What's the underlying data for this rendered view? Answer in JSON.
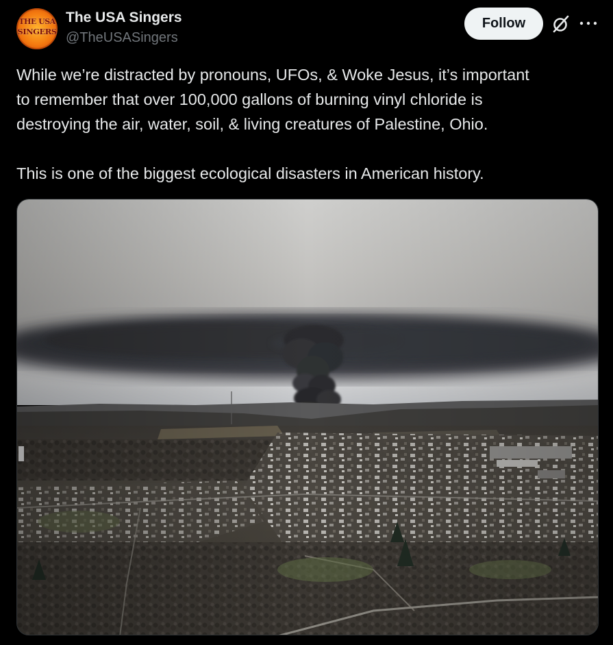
{
  "author": {
    "display_name": "The USA Singers",
    "handle": "@TheUSASingers",
    "avatar": {
      "logo_line1": "THE USA",
      "logo_line2": "SINGERS"
    }
  },
  "actions": {
    "follow_label": "Follow",
    "grok_icon": "grok-icon",
    "more_icon": "more-icon"
  },
  "tweet": {
    "lines_paragraph1": [
      "While we’re distracted by pronouns, UFOs, & Woke Jesus, it’s important",
      "to remember that over 100,000 gallons of burning vinyl chloride is",
      "destroying the air, water, soil, & living creatures of Palestine, Ohio."
    ],
    "paragraph2": "This is one of the biggest ecological disasters in American history."
  },
  "colors": {
    "background": "#000000",
    "text_primary": "#e7e9ea",
    "text_secondary": "#71767b",
    "button_bg": "#eff3f4",
    "button_text": "#0f1419"
  }
}
